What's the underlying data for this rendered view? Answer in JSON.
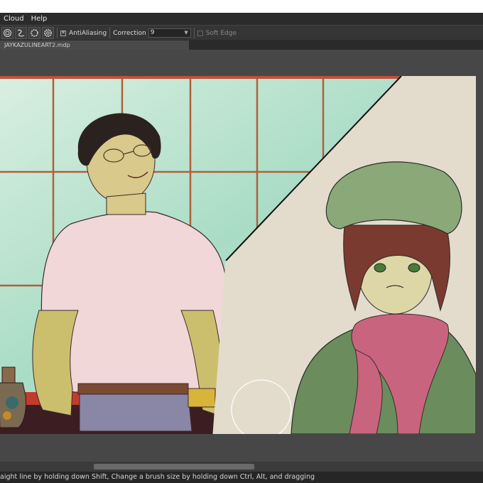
{
  "menu": {
    "items": [
      "Cloud",
      "Help"
    ]
  },
  "toolbar": {
    "antialiasing_label": "AntiAliasing",
    "correction_label": "Correction",
    "correction_value": "9",
    "soft_edge_label": "Soft Edge"
  },
  "tab": {
    "title": "JAYKAZULINEART2.mdp"
  },
  "status": {
    "text": "aight line by holding down Shift, Change a brush size by holding down Ctrl, Alt, and dragging"
  },
  "colors": {
    "accent": "#c0513a",
    "workspace": "#474747",
    "canvas_bg": "#e4ddd0"
  },
  "icons": [
    "brush-target-icon",
    "stroke-curve-icon",
    "gear-outline-icon",
    "gear-icon"
  ]
}
